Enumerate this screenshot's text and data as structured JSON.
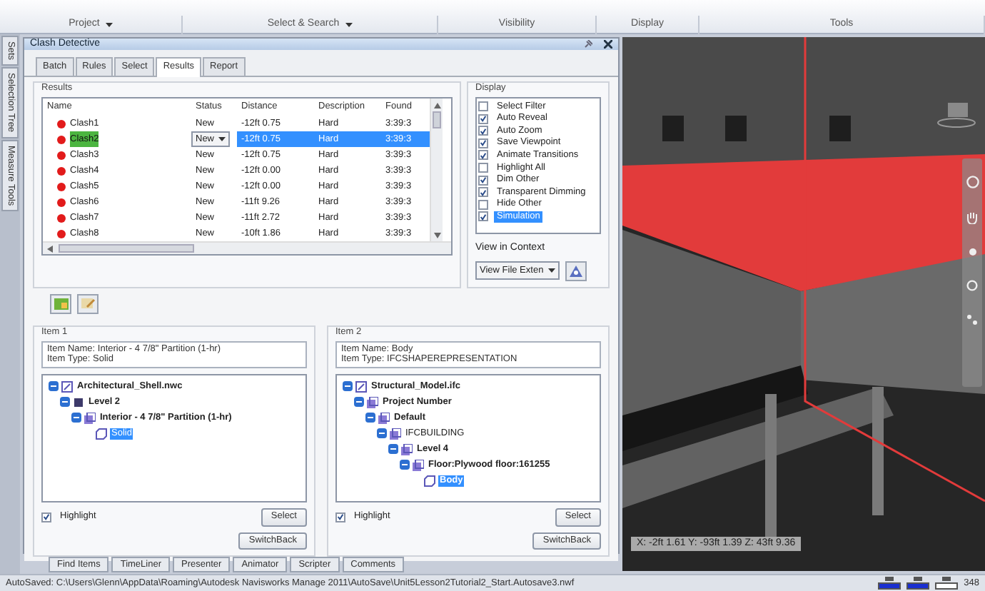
{
  "ribbon": {
    "groups": [
      {
        "label": "Project",
        "has_menu": true
      },
      {
        "label": "Select & Search",
        "has_menu": true
      },
      {
        "label": "Visibility",
        "has_menu": false
      },
      {
        "label": "Display",
        "has_menu": false
      },
      {
        "label": "Tools",
        "has_menu": false
      }
    ]
  },
  "side_tabs": [
    {
      "label": "Sets"
    },
    {
      "label": "Selection Tree"
    },
    {
      "label": "Measure Tools"
    }
  ],
  "panel": {
    "title": "Clash Detective",
    "tabs": [
      {
        "label": "Batch",
        "selected": false
      },
      {
        "label": "Rules",
        "selected": false
      },
      {
        "label": "Select",
        "selected": false
      },
      {
        "label": "Results",
        "selected": true
      },
      {
        "label": "Report",
        "selected": false
      }
    ],
    "results": {
      "title": "Results",
      "columns": [
        "Name",
        "Status",
        "Distance",
        "Description",
        "Found"
      ],
      "rows": [
        {
          "name": "Clash1",
          "status": "New",
          "distance": "-12ft 0.75",
          "description": "Hard",
          "found": "3:39:3",
          "selected": false,
          "editing": false
        },
        {
          "name": "Clash2",
          "status": "New",
          "distance": "-12ft 0.75",
          "description": "Hard",
          "found": "3:39:3",
          "selected": true,
          "editing": true
        },
        {
          "name": "Clash3",
          "status": "New",
          "distance": "-12ft 0.75",
          "description": "Hard",
          "found": "3:39:3",
          "selected": false,
          "editing": false
        },
        {
          "name": "Clash4",
          "status": "New",
          "distance": "-12ft 0.00",
          "description": "Hard",
          "found": "3:39:3",
          "selected": false,
          "editing": false
        },
        {
          "name": "Clash5",
          "status": "New",
          "distance": "-12ft 0.00",
          "description": "Hard",
          "found": "3:39:3",
          "selected": false,
          "editing": false
        },
        {
          "name": "Clash6",
          "status": "New",
          "distance": "-11ft 9.26",
          "description": "Hard",
          "found": "3:39:3",
          "selected": false,
          "editing": false
        },
        {
          "name": "Clash7",
          "status": "New",
          "distance": "-11ft 2.72",
          "description": "Hard",
          "found": "3:39:3",
          "selected": false,
          "editing": false
        },
        {
          "name": "Clash8",
          "status": "New",
          "distance": "-10ft 1.86",
          "description": "Hard",
          "found": "3:39:3",
          "selected": false,
          "editing": false
        }
      ]
    },
    "display": {
      "title": "Display",
      "options": [
        {
          "label": "Select Filter",
          "checked": false,
          "selected": false
        },
        {
          "label": "Auto Reveal",
          "checked": true,
          "selected": false
        },
        {
          "label": "Auto Zoom",
          "checked": true,
          "selected": false
        },
        {
          "label": "Save Viewpoint",
          "checked": true,
          "selected": false
        },
        {
          "label": "Animate Transitions",
          "checked": true,
          "selected": false
        },
        {
          "label": "Highlight All",
          "checked": false,
          "selected": false
        },
        {
          "label": "Dim Other",
          "checked": true,
          "selected": false
        },
        {
          "label": "Transparent Dimming",
          "checked": true,
          "selected": false
        },
        {
          "label": "Hide Other",
          "checked": false,
          "selected": false
        },
        {
          "label": "Simulation",
          "checked": true,
          "selected": true
        }
      ],
      "view_in_context": {
        "label": "View in Context",
        "value": "View File Exten"
      }
    },
    "items": [
      {
        "title": "Item 1",
        "info": [
          "Item Name: Interior - 4 7/8\" Partition (1-hr)",
          "Item Type: Solid"
        ],
        "tree": [
          {
            "label": "Architectural_Shell.nwc",
            "kind": "file",
            "bold": true,
            "selected": false,
            "children": [
              {
                "label": "Level 2",
                "kind": "layer",
                "bold": true,
                "selected": false,
                "children": [
                  {
                    "label": "Interior - 4 7/8\" Partition (1-hr)",
                    "kind": "group",
                    "bold": true,
                    "selected": false,
                    "children": [
                      {
                        "label": "Solid",
                        "kind": "geometry",
                        "bold": false,
                        "selected": true
                      }
                    ]
                  }
                ]
              }
            ]
          }
        ],
        "highlight": true,
        "highlight_label": "Highlight",
        "buttons": [
          "Select",
          "SwitchBack"
        ]
      },
      {
        "title": "Item 2",
        "info": [
          "Item Name: Body",
          "Item Type: IFCSHAPEREPRESENTATION"
        ],
        "tree": [
          {
            "label": "Structural_Model.ifc",
            "kind": "file",
            "bold": true,
            "selected": false,
            "children": [
              {
                "label": "Project Number",
                "kind": "group",
                "bold": true,
                "selected": false,
                "children": [
                  {
                    "label": "Default",
                    "kind": "group",
                    "bold": true,
                    "selected": false,
                    "children": [
                      {
                        "label": "IFCBUILDING",
                        "kind": "group",
                        "bold": false,
                        "selected": false,
                        "children": [
                          {
                            "label": "Level 4",
                            "kind": "group",
                            "bold": true,
                            "selected": false,
                            "children": [
                              {
                                "label": "Floor:Plywood floor:161255",
                                "kind": "group",
                                "bold": true,
                                "selected": false,
                                "children": [
                                  {
                                    "label": "Body",
                                    "kind": "geometry",
                                    "bold": true,
                                    "selected": true
                                  }
                                ]
                              }
                            ]
                          }
                        ]
                      }
                    ]
                  }
                ]
              }
            ]
          }
        ],
        "highlight": true,
        "highlight_label": "Highlight",
        "buttons": [
          "Select",
          "SwitchBack"
        ]
      }
    ]
  },
  "bottom_tabs": [
    {
      "label": "Find Items"
    },
    {
      "label": "TimeLiner"
    },
    {
      "label": "Presenter"
    },
    {
      "label": "Animator"
    },
    {
      "label": "Scripter"
    },
    {
      "label": "Comments"
    }
  ],
  "viewport": {
    "kind": "picture",
    "coordinates": "X: -2ft 1.61  Y: -93ft 1.39  Z: 43ft 9.36"
  },
  "status_bar": {
    "text": "AutoSaved: C:\\Users\\Glenn\\AppData\\Roaming\\Autodesk Navisworks Manage 2011\\AutoSave\\Unit5Lesson2Tutorial2_Start.Autosave3.nwf",
    "memory": "348"
  }
}
